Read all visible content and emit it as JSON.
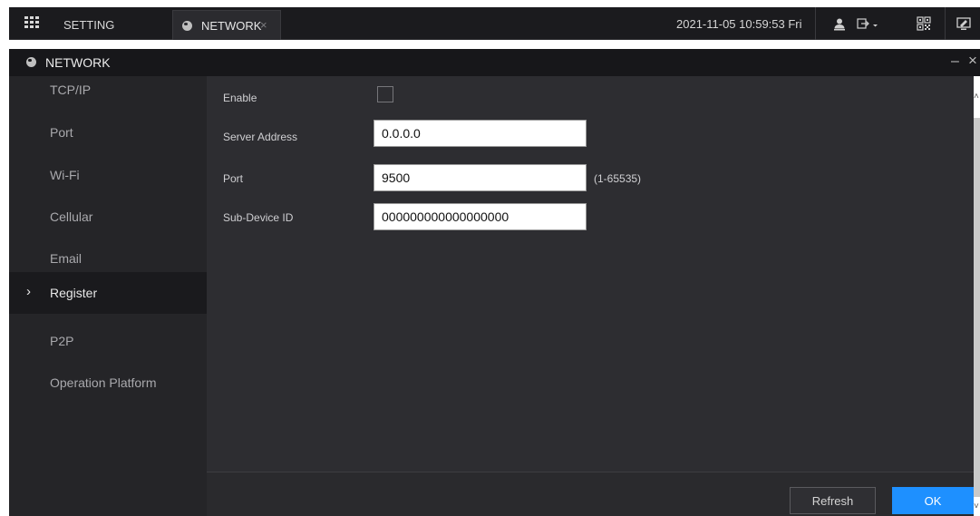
{
  "topbar": {
    "menu_icon": "grid-icon",
    "setting_label": "SETTING",
    "active_tab": {
      "label": "NETWORK",
      "icon": "globe-icon",
      "close": "×"
    },
    "datetime": "2021-11-05 10:59:53 Fri",
    "icons": [
      "user-icon",
      "logout-icon",
      "qr-code-icon",
      "monitor-icon"
    ]
  },
  "window": {
    "title": "NETWORK",
    "minimize": "–",
    "close": "×"
  },
  "sidebar": {
    "items": [
      {
        "label": "TCP/IP"
      },
      {
        "label": "Port"
      },
      {
        "label": "Wi-Fi"
      },
      {
        "label": "Cellular"
      },
      {
        "label": "Email"
      },
      {
        "label": "Register",
        "active": true,
        "marker": "›"
      },
      {
        "label": "P2P"
      },
      {
        "label": "Operation Platform"
      }
    ]
  },
  "form": {
    "enable": {
      "label": "Enable",
      "checked": false
    },
    "server_address": {
      "label": "Server Address",
      "value": "0.0.0.0"
    },
    "port": {
      "label": "Port",
      "value": "9500",
      "hint": "(1-65535)"
    },
    "sub_device_id": {
      "label": "Sub-Device ID",
      "value": "000000000000000000"
    }
  },
  "footer": {
    "refresh_label": "Refresh",
    "ok_label": "OK"
  },
  "colors": {
    "accent": "#1e90ff",
    "background": "#2d2d31",
    "sidebar": "#252528"
  }
}
